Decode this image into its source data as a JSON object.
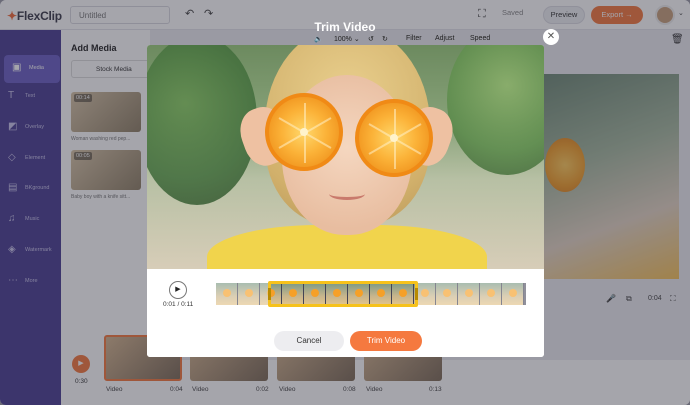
{
  "app": {
    "logo": "FlexClip",
    "title_placeholder": "Untitled",
    "saved_label": "Saved",
    "preview_label": "Preview",
    "export_label": "Export"
  },
  "sidebar": {
    "items": [
      {
        "label": "Media",
        "icon": "media-icon"
      },
      {
        "label": "Text",
        "icon": "text-icon"
      },
      {
        "label": "Overlay",
        "icon": "overlay-icon"
      },
      {
        "label": "Element",
        "icon": "element-icon"
      },
      {
        "label": "BKground",
        "icon": "background-icon"
      },
      {
        "label": "Music",
        "icon": "music-icon"
      },
      {
        "label": "Watermark",
        "icon": "watermark-icon"
      },
      {
        "label": "More",
        "icon": "more-icon"
      }
    ]
  },
  "media_panel": {
    "title": "Add Media",
    "stock_label": "Stock Media",
    "items": [
      {
        "duration": "00:14",
        "caption": "Woman washing red pep..."
      },
      {
        "duration": "00:05",
        "caption": "Baby boy with a knife sitt..."
      }
    ]
  },
  "canvas": {
    "time": "0:04"
  },
  "timeline": {
    "time": "0:30",
    "clips": [
      {
        "label": "Video",
        "duration": "0:04"
      },
      {
        "label": "Video",
        "duration": "0:02"
      },
      {
        "label": "Video",
        "duration": "0:08"
      },
      {
        "label": "Video",
        "duration": "0:13"
      }
    ]
  },
  "modal": {
    "title": "Trim Video",
    "toolbar": {
      "zoom": "100%",
      "filter": "Filter",
      "adjust": "Adjust",
      "speed": "Speed"
    },
    "time_readout": "0:01 / 0:11",
    "cancel_label": "Cancel",
    "trim_label": "Trim Video"
  },
  "colors": {
    "accent": "#f5793f",
    "sidebar": "#4a3e93",
    "trim_frame": "#f6c21b"
  }
}
